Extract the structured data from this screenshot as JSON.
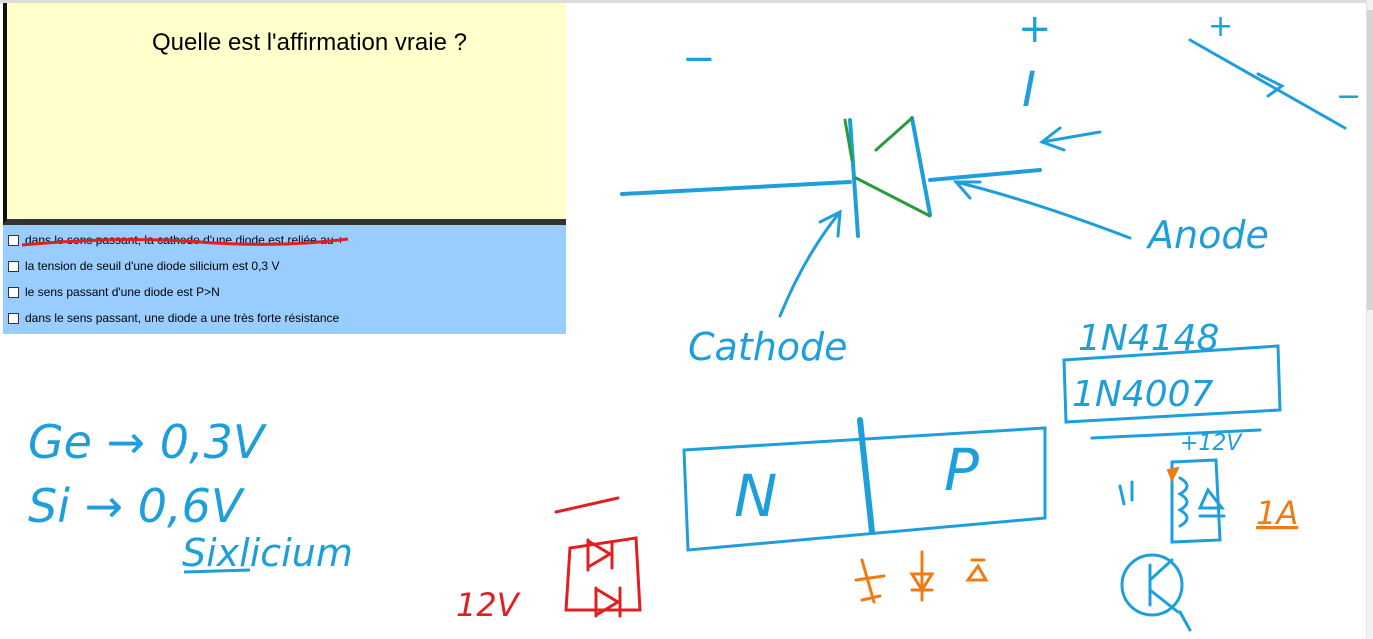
{
  "quiz": {
    "question": "Quelle est l'affirmation vraie ?",
    "answers": [
      {
        "label": "dans le sens passant, la cathode d'une diode est reliée au +",
        "checked": false
      },
      {
        "label": "la tension de seuil d'une diode silicium est 0,3 V",
        "checked": false
      },
      {
        "label": "le sens passant d'une diode est P>N",
        "checked": false
      },
      {
        "label": "dans le sens passant, une diode a une très forte résistance",
        "checked": false
      }
    ]
  },
  "annotations": {
    "plus_top": "+",
    "current_symbol": "I",
    "minus_left": "−",
    "plus_right": "+",
    "minus_right": "−",
    "anode_label": "Anode",
    "cathode_label": "Cathode",
    "ref_1": "1N4148",
    "ref_2": "1N4007",
    "n_region": "N",
    "p_region": "P",
    "plus_12v": "+12V",
    "current_1a": "1A",
    "voltage_12v": "12V",
    "ge_line": "Ge  → 0,3V",
    "si_line": "Si  → 0,6V",
    "silicium_word": "Sixlicium"
  },
  "colors": {
    "ink_blue": "#1e9fdc",
    "ink_red": "#e02020",
    "ink_orange": "#f07b10",
    "ink_green": "#2a9a3a",
    "question_bg": "#ffffcc",
    "answers_bg": "#99ccff"
  }
}
